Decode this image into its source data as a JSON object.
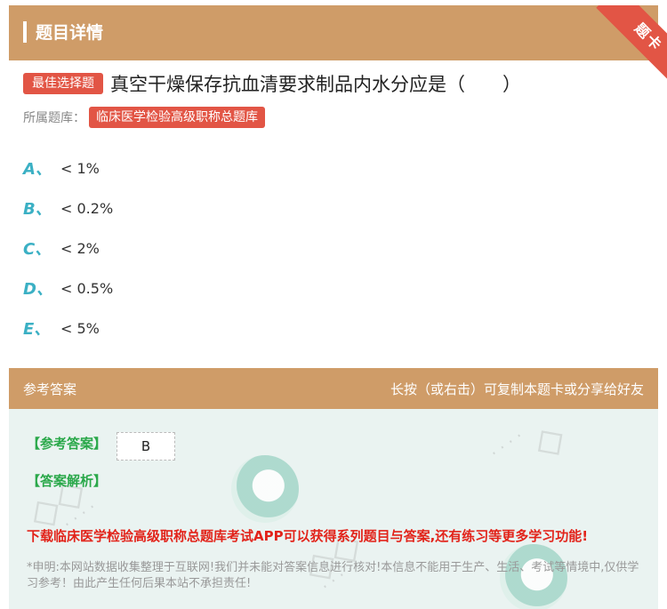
{
  "header": {
    "title": "题目详情",
    "corner_badge": "题卡"
  },
  "question": {
    "type_tag": "最佳选择题",
    "text": "真空干燥保存抗血清要求制品内水分应是（　　）",
    "bank_label": "所属题库：",
    "bank_name": "临床医学检验高级职称总题库"
  },
  "options": [
    {
      "letter": "A、",
      "text": "< 1%"
    },
    {
      "letter": "B、",
      "text": "< 0.2%"
    },
    {
      "letter": "C、",
      "text": "< 2%"
    },
    {
      "letter": "D、",
      "text": "< 0.5%"
    },
    {
      "letter": "E、",
      "text": "< 5%"
    }
  ],
  "answer_section": {
    "title": "参考答案",
    "hint": "长按（或右击）可复制本题卡或分享给好友",
    "answer_label": "【参考答案】",
    "answer_value": "B",
    "analysis_label": "【答案解析】",
    "download_text": "下载临床医学检验高级职称总题库考试APP可以获得系列题目与答案,还有练习等更多学习功能!",
    "disclaimer": "*申明:本网站数据收集整理于互联网!我们并未能对答案信息进行核对!本信息不能用于生产、生活、考试等情境中,仅供学习参考！由此产生任何后果本站不承担责任!"
  },
  "colors": {
    "header_bg": "#cf9c68",
    "tag_red": "#e25545",
    "option_letter": "#3bb0c4",
    "answer_green": "#2aa84a",
    "download_red": "#e2231a"
  }
}
